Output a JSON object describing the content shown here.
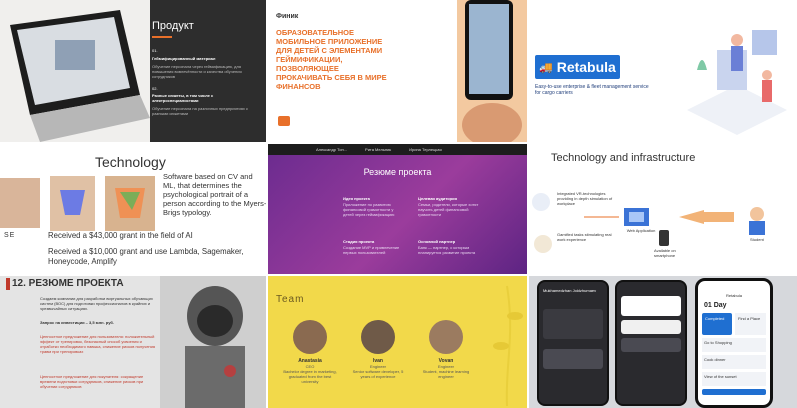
{
  "t1": {
    "title": "Продукт",
    "i1": "01.",
    "i1h": "Геймифицированный материал",
    "i1t": "Обучение персонала через геймификацию, для повышения вовлечённости и качества обучения сотрудников",
    "i2": "02.",
    "i2h": "Разные сюжеты, в том числе с электроcпециалистами",
    "i2t": "Обучение персонала на различных предприятиях с разными сюжетами"
  },
  "t2": {
    "brand": "Финик",
    "heading": "ОБРАЗОВАТЕЛЬНОЕ МОБИЛЬНОЕ ПРИЛОЖЕНИЕ ДЛЯ ДЕТЕЙ С ЭЛЕМЕНТАМИ ГЕЙМИФИКАЦИИ, ПОЗВОЛЯЮЩЕЕ ПРОКАЧИВАТЬ СЕБЯ В МИРЕ ФИНАНСОВ"
  },
  "t3": {
    "logo": "Retabula",
    "sub": "Easy-to-use enterprise & fleet management service for cargo carriers"
  },
  "t4": {
    "title": "Technology",
    "body": "Software based on CV and ML, that determines the psychological portrait of a person according to the Myers-Brigs typology.",
    "brand": "SE",
    "grant1": "Received a $43,000 grant in the field of AI",
    "grant2": "Received a $10,000 grant and use Lambda, Sagemaker, Honeycode, Amplify"
  },
  "t5": {
    "title": "Резюме проекта",
    "tabs": [
      "Александр Тон...",
      "Рита Мельник",
      "Ирина Терлецкая"
    ],
    "c1h": "Идея проекта",
    "c1t": "Приложение по развитию финансовой грамотности у детей через геймификацию",
    "c2h": "Целевая аудитория",
    "c2t": "Семьи, родители, которые хотят научить детей финансовой грамотности",
    "c3h": "Стадия проекта",
    "c3t": "Создание MVP и привлечение первых пользователей",
    "c4h": "Основной партнер",
    "c4t": "Банк — партнер, с которым планируется развитие проекта"
  },
  "t6": {
    "title": "Technology and infrastructure",
    "n1": "Integrated VR-technologies providing in depth simulation of workplace",
    "n2": "Gamified tasks stimulating real work experience",
    "n3": "Web Application",
    "n4": "Available on smartphone",
    "n5": "Student"
  },
  "t7": {
    "title": "12. РЕЗЮМЕ ПРОЕКТА",
    "intro": "Создаем компании для разработки виртуальных обучающих систем (ВОС) для подготовки профессионалов в крайних и чрезвычайных ситуациях.",
    "b1": "Запрос на инвестиции – 3,5 млн. руб.",
    "b2": "Ценностное предложение для пользователя: положительный эффект от тренировок, безопасный способ усвоения и отработки необходимого навыка, снижение рисков получения травм при тренировках",
    "b3": "Ценностное предложение для покупателя: сокращение времени подготовки сотрудников, снижение рисков при обучении сотрудников"
  },
  "t8": {
    "title": "Team",
    "members": [
      {
        "name": "Anastasia",
        "role": "CEO",
        "desc": "Bachelor degree in marketing, graduated from the best university"
      },
      {
        "name": "Ivan",
        "role": "Engineer",
        "desc": "Senior software developer, 5 years of experience"
      },
      {
        "name": "Vovan",
        "role": "Engineer",
        "desc": "Student, machine learning engineer"
      }
    ]
  },
  "t9": {
    "p1": "Mukhamedzhan Joldzhumaev",
    "p2": "Retabula",
    "p3": "01 Day",
    "p3a": "Completed",
    "p3b": "Find a Place",
    "p3c": "Go to Shopping",
    "p3d": "Cook dinner",
    "p3e": "View of the sunset"
  },
  "colors": {
    "orange": "#e8702a",
    "retabula_blue": "#1f6fd1",
    "purple": "#7b2f93",
    "team_yellow": "#f2d94a",
    "red_title": "#c0392b"
  }
}
